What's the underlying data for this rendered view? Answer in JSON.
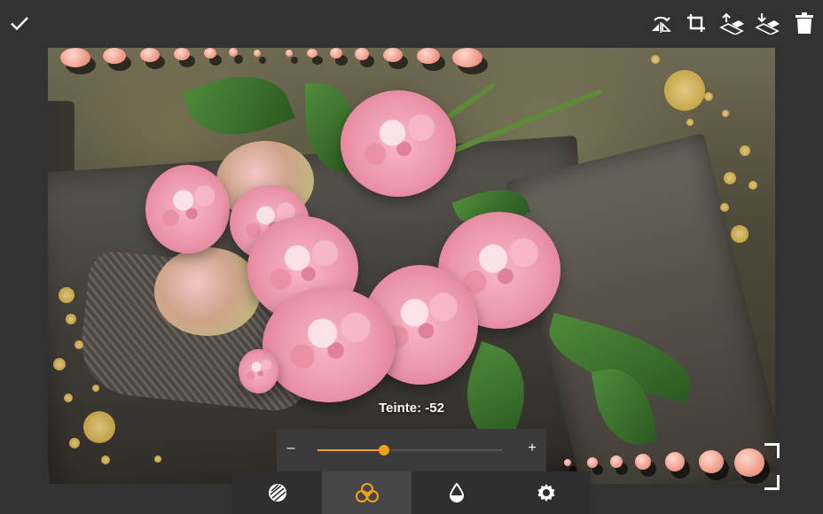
{
  "toolbar": {
    "confirm_icon": "check-icon",
    "icons": [
      "flip-icon",
      "crop-icon",
      "layer-up-icon",
      "layer-down-icon",
      "trash-icon"
    ]
  },
  "adjustment": {
    "label": "Teinte: -52",
    "minus": "–",
    "plus": "+",
    "slider_fraction": 0.36,
    "accent_color": "#f2a21a"
  },
  "tabs": [
    {
      "icon": "texture-icon",
      "active": false
    },
    {
      "icon": "color-circles-icon",
      "active": true
    },
    {
      "icon": "drop-icon",
      "active": false
    },
    {
      "icon": "gear-icon",
      "active": false
    }
  ],
  "colors": {
    "background": "#323232",
    "panel": "#3b3b3b",
    "active_tab": "#464646",
    "accent": "#f2a21a"
  }
}
